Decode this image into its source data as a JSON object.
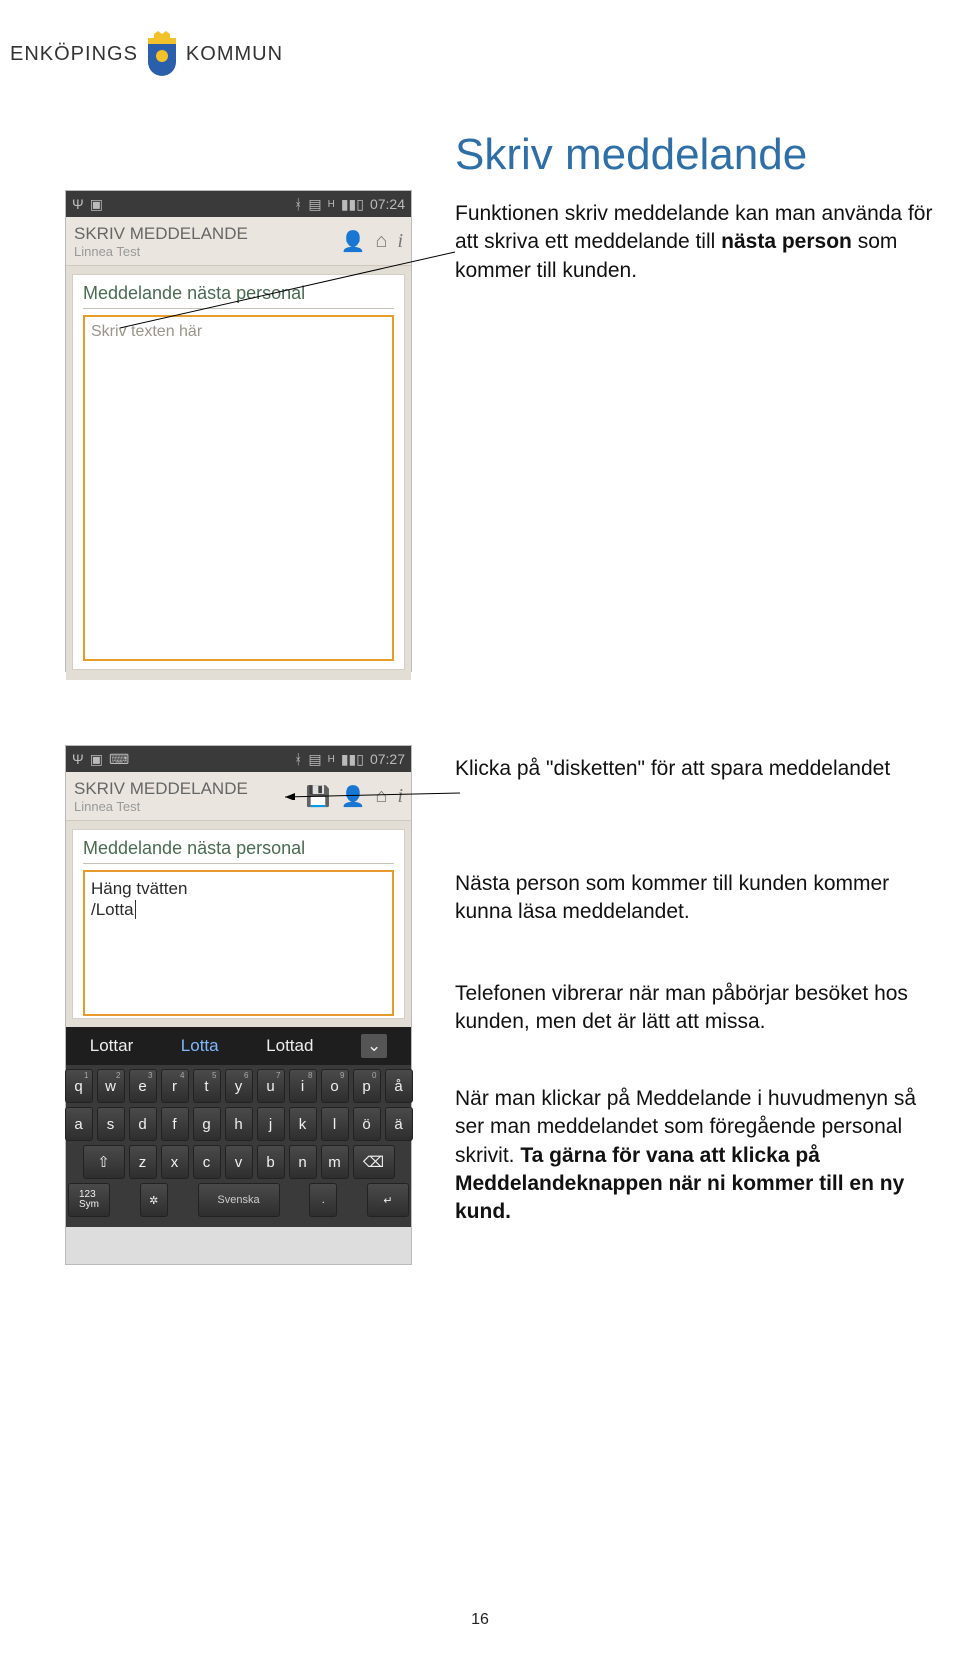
{
  "logo": {
    "left": "ENKÖPINGS",
    "right": "KOMMUN"
  },
  "title": "Skriv meddelande",
  "paragraphs": {
    "p1a": "Funktionen skriv meddelande kan man använda för att skriva ett meddelande till ",
    "p1b": "nästa person",
    "p1c": " som kommer till kunden.",
    "p2": "Klicka på \"disketten\" för att spara meddelandet",
    "p3": "Nästa person som kommer till kunden kommer kunna läsa meddelandet.",
    "p4": "Telefonen vibrerar när man påbörjar besöket hos kunden, men det är lätt att missa.",
    "p5a": "När man klickar på Meddelande i huvudmenyn så ser man meddelandet som föregående personal skrivit. ",
    "p5b": "Ta gärna för vana att klicka på Meddelandeknappen när ni kommer till en ny kund."
  },
  "phone1": {
    "time": "07:24",
    "screen_title": "SKRIV MEDDELANDE",
    "screen_sub": "Linnea Test",
    "card_header": "Meddelande nästa personal",
    "placeholder": "Skriv texten här"
  },
  "phone2": {
    "time": "07:27",
    "screen_title": "SKRIV MEDDELANDE",
    "screen_sub": "Linnea Test",
    "card_header": "Meddelande nästa personal",
    "text_line1": "Häng tvätten",
    "text_line2": "/Lotta",
    "suggest": [
      "Lottar",
      "Lotta",
      "Lottad"
    ]
  },
  "keyboard": {
    "row1": [
      "q",
      "w",
      "e",
      "r",
      "t",
      "y",
      "u",
      "i",
      "o",
      "p",
      "å"
    ],
    "row1sup": [
      "1",
      "2",
      "3",
      "4",
      "5",
      "6",
      "7",
      "8",
      "9",
      "0",
      ""
    ],
    "row2": [
      "a",
      "s",
      "d",
      "f",
      "g",
      "h",
      "j",
      "k",
      "l",
      "ö",
      "ä"
    ],
    "row3": [
      "z",
      "x",
      "c",
      "v",
      "b",
      "n",
      "m"
    ],
    "sym": "123\nSym",
    "lang": "Svenska",
    "dot": "."
  },
  "footer_page": "16"
}
